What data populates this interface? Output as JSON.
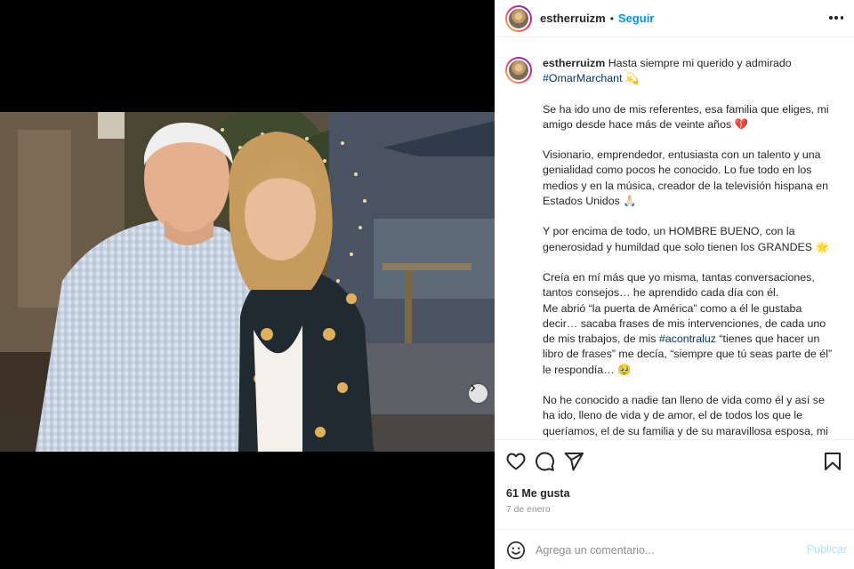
{
  "post": {
    "username": "estherruizm",
    "follow_label": "Seguir",
    "separator": "•"
  },
  "caption": {
    "username": "estherruizm",
    "first_line": "Hasta siempre mi querido y admirado",
    "hashtag1": "#OmarMarchant",
    "emoji1": "💫",
    "para1": "Se ha ido uno de mis referentes, esa familia que eliges, mi amigo desde hace más de veinte años",
    "emoji2": "💔",
    "para2": "Visionario, emprendedor, entusiasta con un talento y una genialidad como pocos he conocido. Lo fue todo en los medios y en la música, creador de la televisión hispana en Estados Unidos",
    "emoji3": "🙏🏻",
    "para3": "Y por encima de todo, un HOMBRE BUENO, con la generosidad y humildad que solo tienen los GRANDES",
    "emoji4": "🌟",
    "para4a": "Creía en mí más que yo misma, tantas conversaciones, tantos consejos… he aprendido cada día con él.",
    "para4b_pre": "Me abrió “la puerta de América” como a él le gustaba decir… sacaba frases de mis intervenciones, de cada uno de mis trabajos, de mis",
    "hashtag2": "#acontraluz",
    "para4b_post": "“tienes que hacer un libro de frases” me decía, “siempre que tú seas parte de él” le respondía…",
    "emoji5": "🥹",
    "para5": "No he conocido a nadie tan lleno de vida como él y así se ha ido, lleno de vida y de amor, el de todos los que le queríamos, el de su familia y de su maravillosa esposa, mi adorada Dorita",
    "emoji6": "❤️"
  },
  "actions": {
    "icons": [
      "heart-icon",
      "comment-icon",
      "share-icon",
      "bookmark-icon"
    ]
  },
  "stats": {
    "likes": "61 Me gusta",
    "date": "7 de enero"
  },
  "comment": {
    "placeholder": "Agrega un comentario...",
    "publish_label": "Publicar"
  },
  "carousel": {
    "total": 4,
    "active_index": 0
  },
  "colors": {
    "link": "#0095f6",
    "hashtag": "#00376b",
    "publish_disabled": "#b2dffc",
    "muted": "#8e8e8e"
  }
}
